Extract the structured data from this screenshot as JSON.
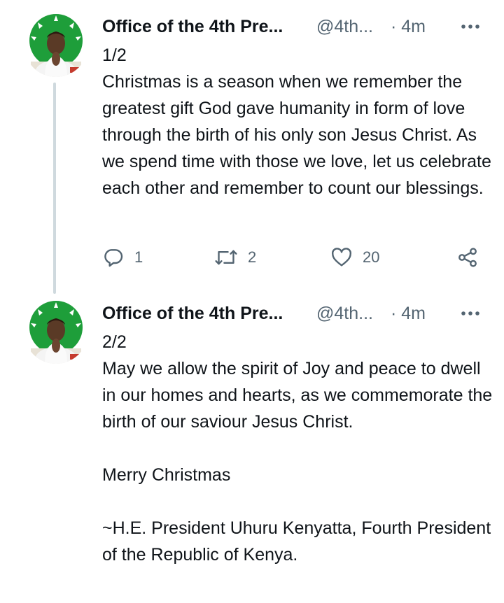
{
  "colors": {
    "text": "#0f1419",
    "secondary": "#536471",
    "thread_line": "#cfd9de",
    "avatar_green": "#1e9e3a"
  },
  "tweets": [
    {
      "name": "Office of the 4th Pre...",
      "handle": "@4th...",
      "time": "· 4m",
      "more_icon": "more-horizontal-icon",
      "paragraphs": [
        "1/2",
        "Christmas is a season when we remember the greatest gift God gave humanity in form of love through the birth of his only son Jesus Christ. As we spend time with those we love, let us celebrate each other and remember to count our blessings."
      ],
      "actions": {
        "reply_count": "1",
        "retweet_count": "2",
        "like_count": "20"
      }
    },
    {
      "name": "Office of the 4th Pre...",
      "handle": "@4th...",
      "time": "· 4m",
      "more_icon": "more-horizontal-icon",
      "paragraphs": [
        "2/2",
        "May we allow the spirit of Joy and peace to dwell in our homes and hearts, as we commemorate the birth of our saviour Jesus Christ.",
        "Merry Christmas",
        "~H.E. President Uhuru Kenyatta, Fourth President of the Republic of Kenya."
      ]
    }
  ]
}
